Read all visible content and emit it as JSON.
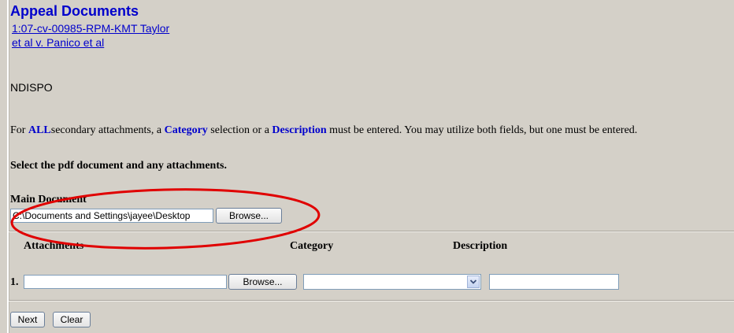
{
  "header": {
    "title": "Appeal Documents",
    "case_link_line1": "1:07-cv-00985-RPM-KMT Taylor",
    "case_link_line2": "et al v. Panico et al"
  },
  "status_text": "NDISPO",
  "notice": {
    "prefix": "For ",
    "all": "ALL",
    "part1": "secondary attachments, a ",
    "category": "Category",
    "part2": " selection or a ",
    "description": "Description",
    "part3": " must be entered. You may utilize both fields, but one must be entered."
  },
  "instruction": "Select the pdf document and any attachments.",
  "main_document": {
    "label": "Main Document",
    "file_value": "C:\\Documents and Settings\\jayee\\Desktop",
    "browse_label": "Browse..."
  },
  "attachments": {
    "headers": {
      "attachments": "Attachments",
      "category": "Category",
      "description": "Description"
    },
    "rows": [
      {
        "number": "1.",
        "file_value": "",
        "browse_label": "Browse...",
        "category_value": "",
        "description_value": ""
      }
    ]
  },
  "actions": {
    "next_label": "Next",
    "clear_label": "Clear"
  },
  "icons": {
    "select_arrow": "chevron-down-icon"
  },
  "colors": {
    "link_blue": "#0000cc",
    "annotation_red": "#e00000",
    "background": "#d4d0c8"
  }
}
